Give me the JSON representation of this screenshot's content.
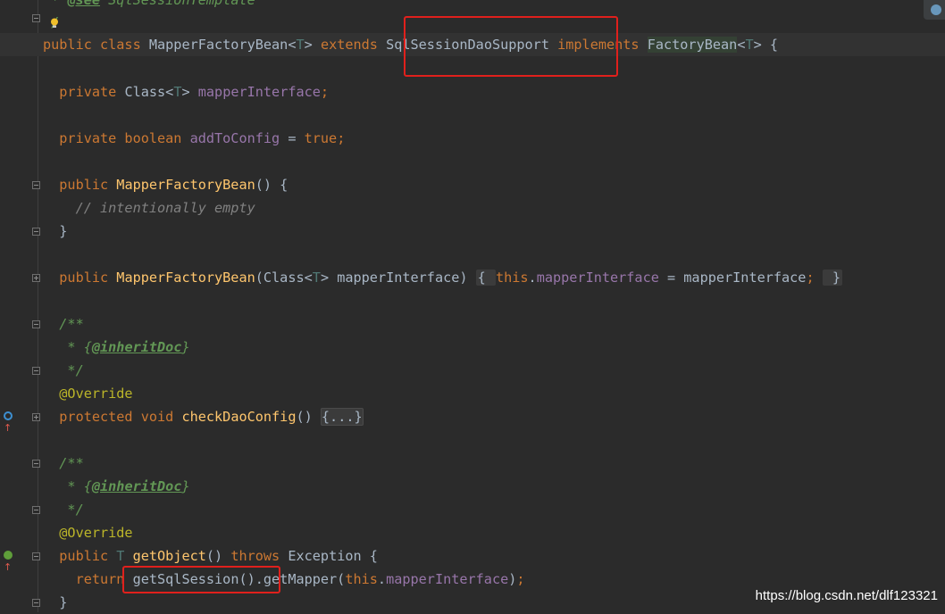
{
  "editor": {
    "lines": [
      {
        "key": "top",
        "segments": [
          {
            "t": " * ",
            "c": "dc"
          },
          {
            "t": "@see",
            "c": "dtag"
          },
          {
            "t": " SqlSessionTemplate",
            "c": "dc"
          }
        ]
      },
      {
        "key": "l1",
        "segments": [
          {
            "t": " /",
            "c": "dc"
          }
        ]
      },
      {
        "key": "l2",
        "segments": [
          {
            "t": "public class ",
            "c": "kw"
          },
          {
            "t": "MapperFactoryBean",
            "c": "id"
          },
          {
            "t": "<",
            "c": "id"
          },
          {
            "t": "T",
            "c": "tp"
          },
          {
            "t": "> ",
            "c": "id"
          },
          {
            "t": "extends ",
            "c": "kw"
          },
          {
            "t": "SqlSessionDaoSupport ",
            "c": "id"
          },
          {
            "t": "implements ",
            "c": "kw"
          },
          {
            "t": "FactoryBean",
            "c": "fb"
          },
          {
            "t": "<",
            "c": "id"
          },
          {
            "t": "T",
            "c": "tp"
          },
          {
            "t": "> {",
            "c": "id"
          }
        ]
      },
      {
        "key": "l3",
        "segments": []
      },
      {
        "key": "l4",
        "segments": [
          {
            "t": "  private ",
            "c": "kw"
          },
          {
            "t": "Class",
            "c": "id"
          },
          {
            "t": "<",
            "c": "id"
          },
          {
            "t": "T",
            "c": "tp"
          },
          {
            "t": "> ",
            "c": "id"
          },
          {
            "t": "mapperInterface",
            "c": "fld"
          },
          {
            "t": ";",
            "c": "kw"
          }
        ]
      },
      {
        "key": "l5",
        "segments": []
      },
      {
        "key": "l6",
        "segments": [
          {
            "t": "  private boolean ",
            "c": "kw"
          },
          {
            "t": "addToConfig",
            "c": "fld"
          },
          {
            "t": " = ",
            "c": "id"
          },
          {
            "t": "true",
            "c": "kw"
          },
          {
            "t": ";",
            "c": "kw"
          }
        ]
      },
      {
        "key": "l7",
        "segments": []
      },
      {
        "key": "l8",
        "segments": [
          {
            "t": "  public ",
            "c": "kw"
          },
          {
            "t": "MapperFactoryBean",
            "c": "fn"
          },
          {
            "t": "() {",
            "c": "id"
          }
        ]
      },
      {
        "key": "l9",
        "segments": [
          {
            "t": "    // intentionally empty",
            "c": "cm"
          }
        ]
      },
      {
        "key": "l10",
        "segments": [
          {
            "t": "  }",
            "c": "id"
          }
        ]
      },
      {
        "key": "l11",
        "segments": []
      },
      {
        "key": "l12",
        "segments": [
          {
            "t": "  public ",
            "c": "kw"
          },
          {
            "t": "MapperFactoryBean",
            "c": "fn"
          },
          {
            "t": "(Class",
            "c": "id"
          },
          {
            "t": "<",
            "c": "id"
          },
          {
            "t": "T",
            "c": "tp"
          },
          {
            "t": "> mapperInterface) ",
            "c": "id"
          },
          {
            "t": "{ ",
            "c": "fold-mark"
          },
          {
            "t": "this",
            "c": "kw"
          },
          {
            "t": ".",
            "c": "id"
          },
          {
            "t": "mapperInterface",
            "c": "fld"
          },
          {
            "t": " = mapperInterface",
            "c": "id"
          },
          {
            "t": ";",
            "c": "kw"
          },
          {
            "t": " ",
            "c": "id"
          },
          {
            "t": " }",
            "c": "fold-mark"
          }
        ]
      },
      {
        "key": "l13",
        "segments": []
      },
      {
        "key": "l14",
        "segments": [
          {
            "t": "  /**",
            "c": "dc"
          }
        ]
      },
      {
        "key": "l15",
        "segments": [
          {
            "t": "   * {",
            "c": "dc"
          },
          {
            "t": "@inheritDoc",
            "c": "dtag"
          },
          {
            "t": "}",
            "c": "dc"
          }
        ]
      },
      {
        "key": "l16",
        "segments": [
          {
            "t": "   */",
            "c": "dc"
          }
        ]
      },
      {
        "key": "l17",
        "segments": [
          {
            "t": "  @Override",
            "c": "ann"
          }
        ]
      },
      {
        "key": "l18",
        "segments": [
          {
            "t": "  protected void ",
            "c": "kw"
          },
          {
            "t": "checkDaoConfig",
            "c": "fn"
          },
          {
            "t": "() ",
            "c": "id"
          },
          {
            "t": "{...}",
            "c": "fold-dots"
          }
        ]
      },
      {
        "key": "l19",
        "segments": []
      },
      {
        "key": "l20",
        "segments": [
          {
            "t": "  /**",
            "c": "dc"
          }
        ]
      },
      {
        "key": "l21",
        "segments": [
          {
            "t": "   * {",
            "c": "dc"
          },
          {
            "t": "@inheritDoc",
            "c": "dtag"
          },
          {
            "t": "}",
            "c": "dc"
          }
        ]
      },
      {
        "key": "l22",
        "segments": [
          {
            "t": "   */",
            "c": "dc"
          }
        ]
      },
      {
        "key": "l23",
        "segments": [
          {
            "t": "  @Override",
            "c": "ann"
          }
        ]
      },
      {
        "key": "l24",
        "segments": [
          {
            "t": "  public ",
            "c": "kw"
          },
          {
            "t": "T",
            "c": "tp"
          },
          {
            "t": " ",
            "c": "id"
          },
          {
            "t": "getObject",
            "c": "fn"
          },
          {
            "t": "() ",
            "c": "id"
          },
          {
            "t": "throws ",
            "c": "kw"
          },
          {
            "t": "Exception {",
            "c": "id"
          }
        ]
      },
      {
        "key": "l25",
        "segments": [
          {
            "t": "    return ",
            "c": "kw"
          },
          {
            "t": "getSqlSession().getMapper(",
            "c": "id"
          },
          {
            "t": "this",
            "c": "kw"
          },
          {
            "t": ".",
            "c": "id"
          },
          {
            "t": "mapperInterface",
            "c": "fld"
          },
          {
            "t": ")",
            "c": "id"
          },
          {
            "t": ";",
            "c": "kw"
          }
        ]
      },
      {
        "key": "l26",
        "segments": [
          {
            "t": "  }",
            "c": "id"
          }
        ]
      }
    ]
  },
  "gutter_icons": {
    "override_up": "overrides-method-icon",
    "implements_up": "implements-method-icon",
    "bulb": "intention-bulb-icon"
  },
  "colors": {
    "background": "#2b2b2b",
    "keyword": "#cc7832",
    "method": "#ffc66d",
    "field": "#9876aa",
    "highlight_box": "#e0201c"
  },
  "watermark": "https://blog.csdn.net/dlf123321"
}
